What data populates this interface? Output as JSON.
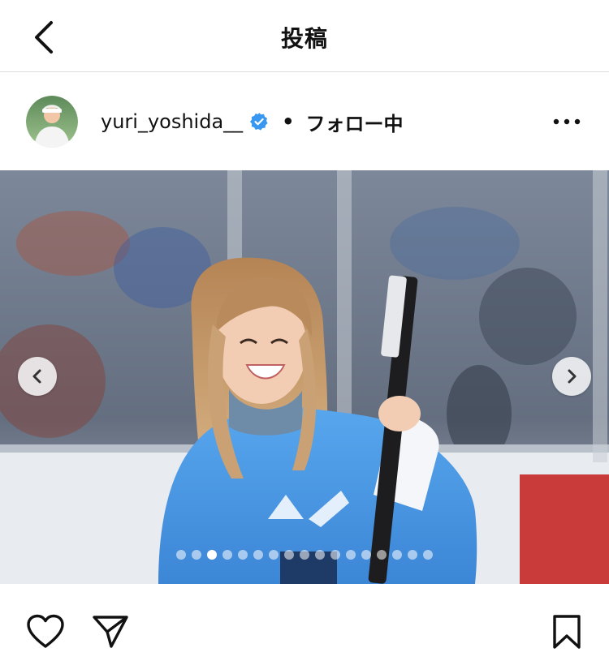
{
  "header": {
    "title": "投稿",
    "back_icon": "chevron-left-icon"
  },
  "post": {
    "username": "yuri_yoshida__",
    "verified": true,
    "separator": "•",
    "follow_status": "フォロー中",
    "more_icon": "more-horizontal-icon"
  },
  "carousel": {
    "total_slides": 17,
    "active_index": 2,
    "prev_icon": "chevron-left-icon",
    "next_icon": "chevron-right-icon"
  },
  "actions": {
    "like_icon": "heart-icon",
    "share_icon": "send-icon",
    "save_icon": "bookmark-icon"
  },
  "colors": {
    "verified_blue": "#3897f0",
    "jersey_blue": "#4a9be8",
    "divider": "#dcdcdc"
  }
}
